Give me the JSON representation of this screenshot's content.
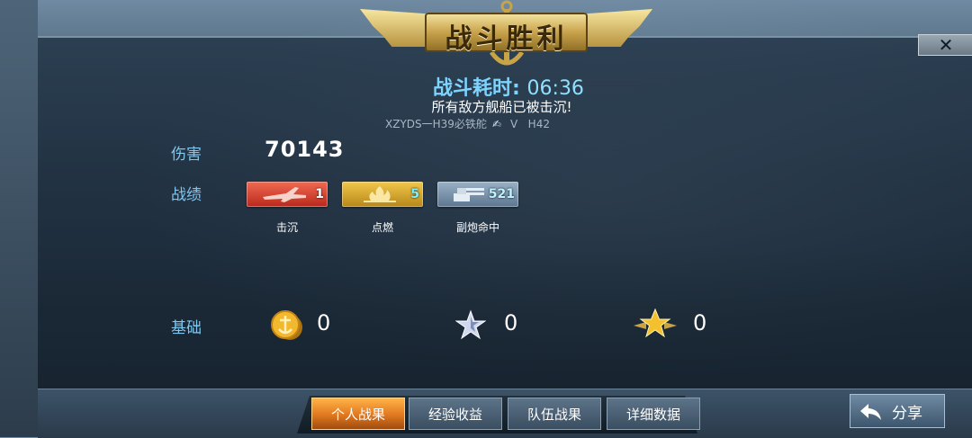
{
  "banner": {
    "title": "战斗胜利"
  },
  "battle": {
    "time_label": "战斗耗时:",
    "time_value": "06:36",
    "message": "所有敌方舰船已被击沉!",
    "player_name": "XZYDS一H39必铁舵",
    "player_rank": "V",
    "player_ship": "H42"
  },
  "stats": {
    "damage_label": "伤害",
    "damage_value": "70143",
    "achievements_label": "战绩",
    "badges": [
      {
        "icon": "sink-plane-icon",
        "count": "1",
        "caption": "击沉",
        "color": "#d8392a"
      },
      {
        "icon": "fire-icon",
        "count": "5",
        "caption": "点燃",
        "color": "#d9a52c"
      },
      {
        "icon": "secondary-gun-icon",
        "count": "521",
        "caption": "副炮命中",
        "color": "#7890a8"
      }
    ],
    "base_label": "基础",
    "base_values": [
      {
        "icon": "gold-coin-icon",
        "value": "0"
      },
      {
        "icon": "silver-star-icon",
        "value": "0"
      },
      {
        "icon": "gold-star-icon",
        "value": "0"
      }
    ]
  },
  "tabs": [
    {
      "label": "个人战果",
      "active": true
    },
    {
      "label": "经验收益",
      "active": false
    },
    {
      "label": "队伍战果",
      "active": false
    },
    {
      "label": "详细数据",
      "active": false
    }
  ],
  "share": {
    "label": "分享"
  },
  "close": {
    "label": "✕"
  },
  "colors": {
    "accent_blue": "#7fd3ff",
    "active_tab": "#e0771f",
    "gold": "#c8a24c"
  }
}
